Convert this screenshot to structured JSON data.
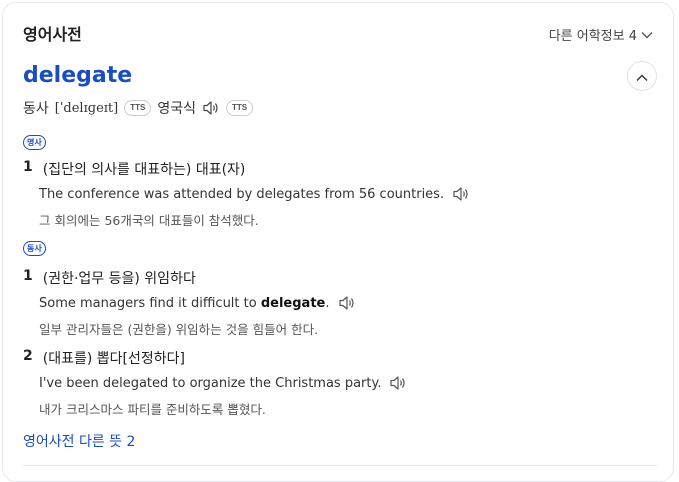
{
  "header": {
    "title": "영어사전",
    "more_label": "다른 어학정보 4"
  },
  "entry": {
    "word": "delegate",
    "pos_label": "동사",
    "phonetic": "[ˈdelɪɡeɪt]",
    "tts_label": "TTS",
    "accent_label": "영국식",
    "tts_label_2": "TTS"
  },
  "senses": [
    {
      "pos_badge": "명사",
      "items": [
        {
          "number": "1",
          "definition": "(집단의 의사를 대표하는) 대표(자)",
          "example": "The conference was attended by delegates from 56 countries.",
          "translation": "그 회의에는 56개국의 대표들이 참석했다."
        }
      ]
    },
    {
      "pos_badge": "동사",
      "items": [
        {
          "number": "1",
          "definition": "(권한·업무 등을) 위임하다",
          "example_before": "Some managers find it difficult to ",
          "example_bold": "delegate",
          "example_after": ".",
          "translation": "일부 관리자들은 (권한을) 위임하는 것을 힘들어 한다."
        },
        {
          "number": "2",
          "definition": "(대표를) 뽑다[선정하다]",
          "example": "I've been delegated to organize the Christmas party.",
          "translation": "내가 크리스마스 파티를 준비하도록 뽑혔다."
        }
      ]
    }
  ],
  "more_meanings_link": "영어사전 다른 뜻 2",
  "colors": {
    "accent": "#1a4dbd",
    "text": "#222222",
    "border": "#e6e8ec"
  },
  "icons": [
    "chevron-down-icon",
    "chevron-up-icon",
    "speaker-icon"
  ]
}
